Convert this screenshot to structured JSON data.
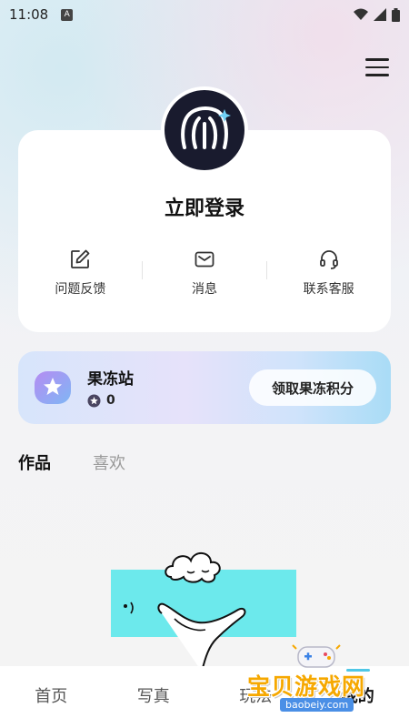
{
  "status_bar": {
    "time": "11:08",
    "notification_badge": "A"
  },
  "profile": {
    "login_label": "立即登录"
  },
  "actions": [
    {
      "label": "问题反馈",
      "icon": "edit-icon"
    },
    {
      "label": "消息",
      "icon": "mail-icon"
    },
    {
      "label": "联系客服",
      "icon": "headset-icon"
    }
  ],
  "jelly_station": {
    "title": "果冻站",
    "points": "0",
    "claim_button": "领取果冻积分"
  },
  "content_tabs": [
    {
      "label": "作品",
      "active": true
    },
    {
      "label": "喜欢",
      "active": false
    }
  ],
  "bottom_nav": [
    {
      "label": "首页",
      "active": false
    },
    {
      "label": "写真",
      "active": false
    },
    {
      "label": "玩法",
      "active": false
    },
    {
      "label": "我的",
      "active": true
    }
  ],
  "watermark": {
    "title": "宝贝游戏网",
    "url": "baobeiy.com"
  },
  "colors": {
    "accent": "#4fc7e6",
    "avatar_bg": "#191b2e",
    "illustration_cyan": "#6ce9ec",
    "watermark_orange": "#f6a800"
  }
}
